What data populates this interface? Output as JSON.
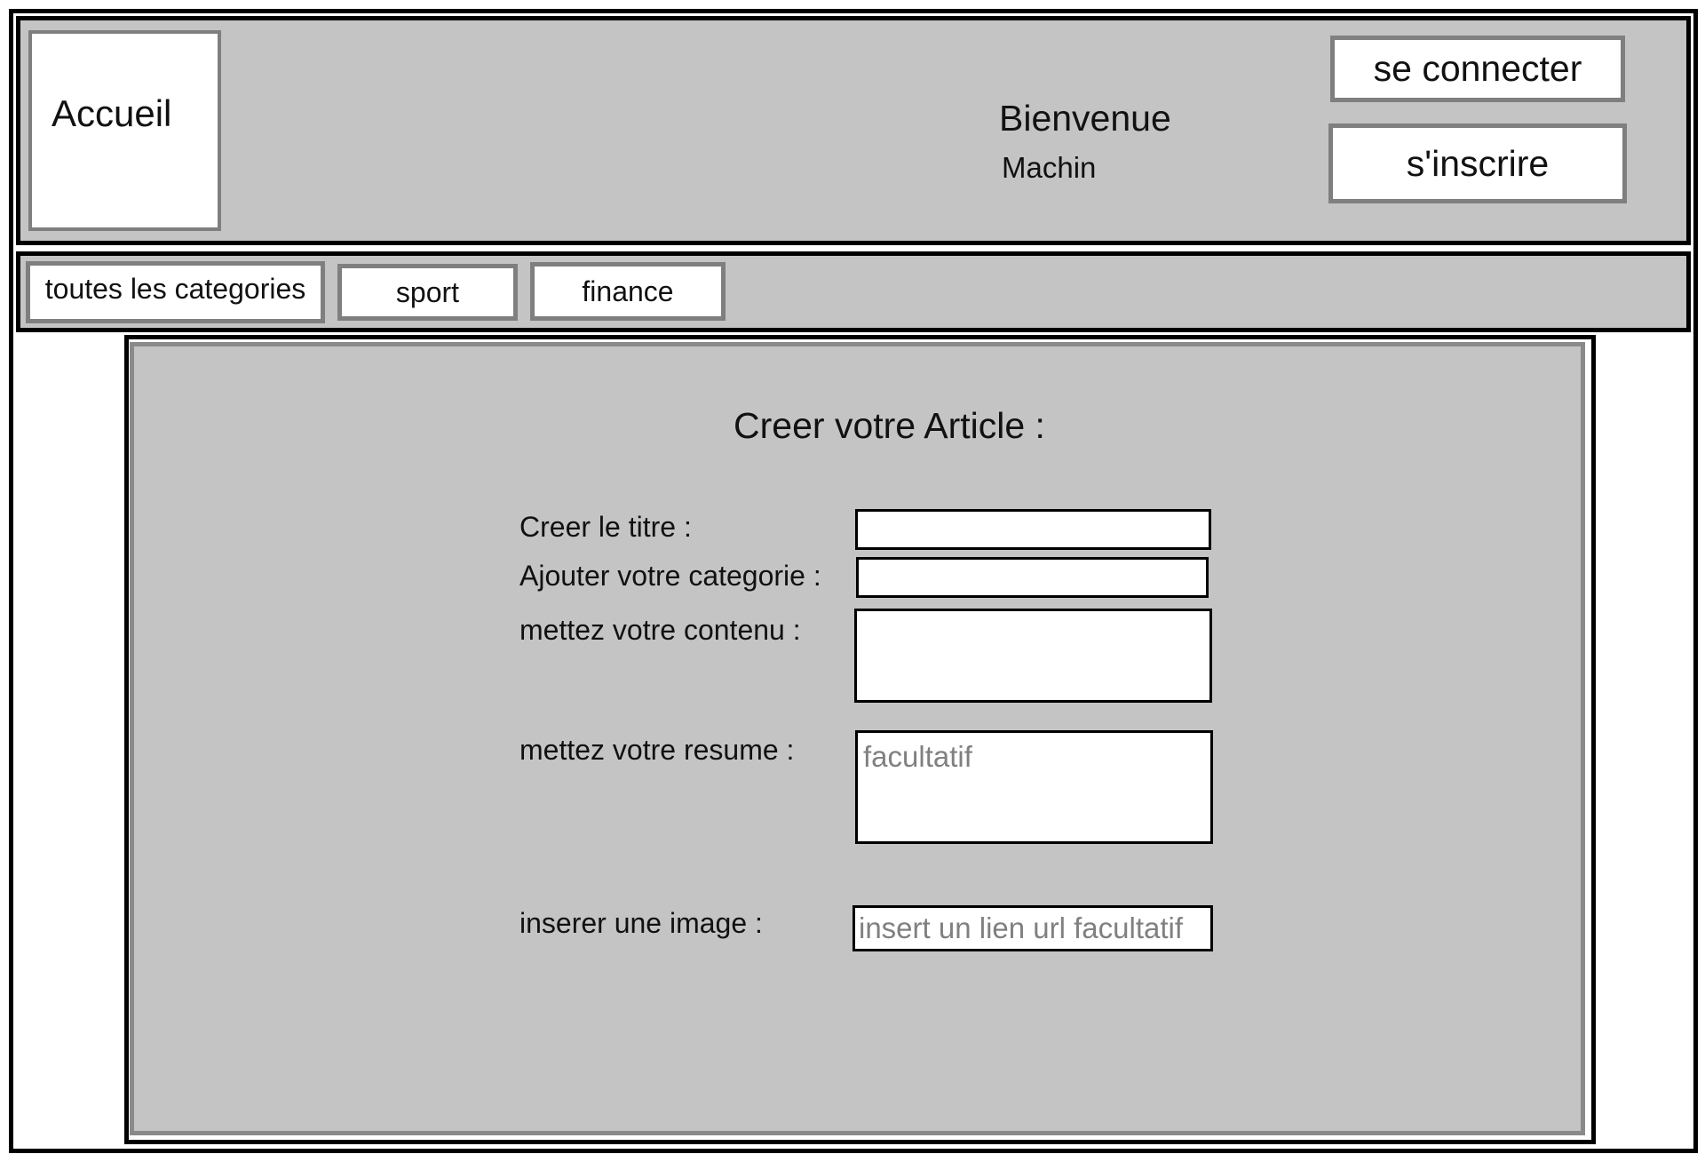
{
  "header": {
    "home_label": "Accueil",
    "welcome": "Bienvenue",
    "username": "Machin",
    "login_label": "se connecter",
    "signup_label": "s'inscrire"
  },
  "nav": {
    "tabs": [
      {
        "label": "toutes les categories"
      },
      {
        "label": "sport"
      },
      {
        "label": "finance"
      }
    ]
  },
  "form": {
    "title": "Creer votre Article :",
    "fields": [
      {
        "label": "Creer le titre :",
        "value": "",
        "placeholder": ""
      },
      {
        "label": "Ajouter votre categorie :",
        "value": "",
        "placeholder": ""
      },
      {
        "label": "mettez votre contenu :",
        "value": "",
        "placeholder": ""
      },
      {
        "label": "mettez votre resume :",
        "value": "",
        "placeholder": "facultatif"
      },
      {
        "label": "inserer une image :",
        "value": "",
        "placeholder": "insert un lien url facultatif"
      }
    ]
  },
  "colors": {
    "panel_gray": "#c4c4c4",
    "border_gray": "#7f7f7f",
    "border_black": "#000000",
    "placeholder_gray": "#808080"
  }
}
